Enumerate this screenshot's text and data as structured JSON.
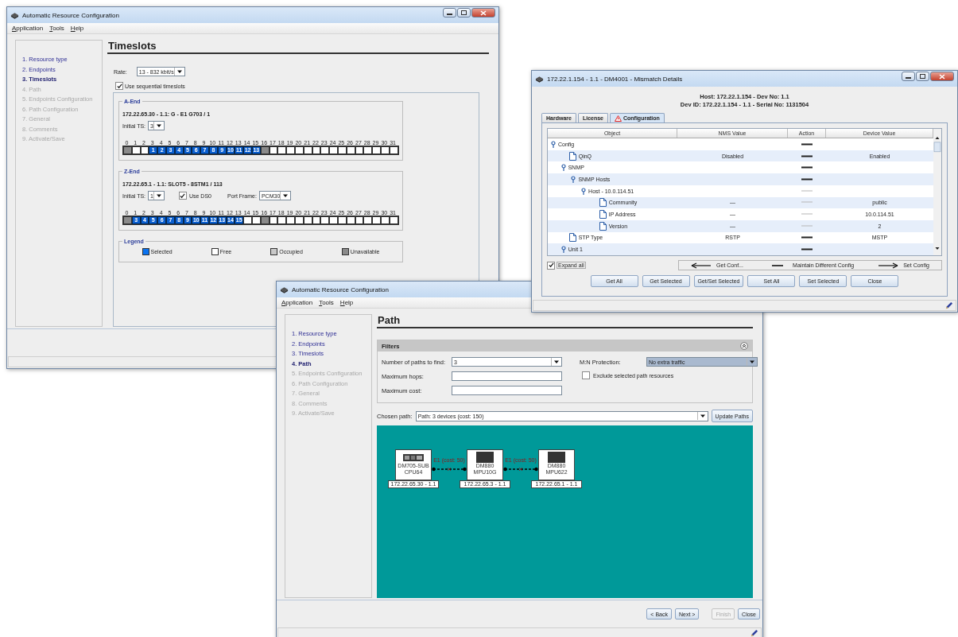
{
  "timeslots_window": {
    "title": "Automatic Resource Configuration",
    "menu": [
      "Application",
      "Tools",
      "Help"
    ],
    "steps": [
      {
        "label": "1. Resource type",
        "selected": false,
        "disabled": false
      },
      {
        "label": "2. Endpoints",
        "selected": false,
        "disabled": false
      },
      {
        "label": "3. Timeslots",
        "selected": true,
        "disabled": false
      },
      {
        "label": "4. Path",
        "selected": false,
        "disabled": true
      },
      {
        "label": "5. Endpoints Configuration",
        "selected": false,
        "disabled": true
      },
      {
        "label": "6. Path Configuration",
        "selected": false,
        "disabled": true
      },
      {
        "label": "7. General",
        "selected": false,
        "disabled": true
      },
      {
        "label": "8. Comments",
        "selected": false,
        "disabled": true
      },
      {
        "label": "9. Activate/Save",
        "selected": false,
        "disabled": true
      }
    ],
    "heading": "Timeslots",
    "rate": {
      "label": "Rate:",
      "value": "13 - 832 kbit/s"
    },
    "sequential": {
      "label": "Use sequential timeslots",
      "checked": true
    },
    "a_end": {
      "title": "A-End",
      "endpoint": "172.22.65.30 - 1.1: G - E1 G703 / 1",
      "initial_ts": {
        "label": "Initial TS:",
        "value": "3"
      },
      "slot_numbers": [
        "0",
        "1",
        "2",
        "3",
        "4",
        "5",
        "6",
        "7",
        "8",
        "9",
        "10",
        "11",
        "12",
        "13",
        "14",
        "15",
        "16",
        "17",
        "18",
        "19",
        "20",
        "21",
        "22",
        "23",
        "24",
        "25",
        "26",
        "27",
        "28",
        "29",
        "30",
        "31"
      ],
      "slots": [
        {
          "kind": "unavailable"
        },
        {
          "kind": "free"
        },
        {
          "kind": "free"
        },
        {
          "kind": "selected",
          "label": "1"
        },
        {
          "kind": "selected",
          "label": "2"
        },
        {
          "kind": "selected",
          "label": "3"
        },
        {
          "kind": "selected",
          "label": "4"
        },
        {
          "kind": "selected",
          "label": "5"
        },
        {
          "kind": "selected",
          "label": "6"
        },
        {
          "kind": "selected",
          "label": "7"
        },
        {
          "kind": "selected",
          "label": "8"
        },
        {
          "kind": "selected",
          "label": "9"
        },
        {
          "kind": "selected",
          "label": "10"
        },
        {
          "kind": "selected",
          "label": "11"
        },
        {
          "kind": "selected",
          "label": "12"
        },
        {
          "kind": "selected",
          "label": "13"
        },
        {
          "kind": "unavailable"
        },
        {
          "kind": "free"
        },
        {
          "kind": "free"
        },
        {
          "kind": "free"
        },
        {
          "kind": "free"
        },
        {
          "kind": "free"
        },
        {
          "kind": "free"
        },
        {
          "kind": "free"
        },
        {
          "kind": "free"
        },
        {
          "kind": "free"
        },
        {
          "kind": "free"
        },
        {
          "kind": "free"
        },
        {
          "kind": "free"
        },
        {
          "kind": "free"
        },
        {
          "kind": "free"
        },
        {
          "kind": "free"
        }
      ]
    },
    "z_end": {
      "title": "Z-End",
      "endpoint": "172.22.65.1 - 1.1: SLOT5 - 8STM1 / 113",
      "initial_ts": {
        "label": "Initial TS:",
        "value": "1"
      },
      "use_ds0": {
        "label": "Use DS0",
        "checked": true
      },
      "port_frame": {
        "label": "Port Frame:",
        "value": "PCM30"
      },
      "slot_numbers": [
        "0",
        "1",
        "2",
        "3",
        "4",
        "5",
        "6",
        "7",
        "8",
        "9",
        "10",
        "11",
        "12",
        "13",
        "14",
        "15",
        "16",
        "17",
        "18",
        "19",
        "20",
        "21",
        "22",
        "23",
        "24",
        "25",
        "26",
        "27",
        "28",
        "29",
        "30",
        "31"
      ],
      "slots": [
        {
          "kind": "unavailable"
        },
        {
          "kind": "selected",
          "label": "3"
        },
        {
          "kind": "selected",
          "label": "4"
        },
        {
          "kind": "selected",
          "label": "5"
        },
        {
          "kind": "selected",
          "label": "6"
        },
        {
          "kind": "selected",
          "label": "7"
        },
        {
          "kind": "selected",
          "label": "8"
        },
        {
          "kind": "selected",
          "label": "9"
        },
        {
          "kind": "selected",
          "label": "10"
        },
        {
          "kind": "selected",
          "label": "11"
        },
        {
          "kind": "selected",
          "label": "12"
        },
        {
          "kind": "selected",
          "label": "13"
        },
        {
          "kind": "selected",
          "label": "14"
        },
        {
          "kind": "selected",
          "label": "15"
        },
        {
          "kind": "free"
        },
        {
          "kind": "free"
        },
        {
          "kind": "unavailable"
        },
        {
          "kind": "free"
        },
        {
          "kind": "free"
        },
        {
          "kind": "free"
        },
        {
          "kind": "free"
        },
        {
          "kind": "free"
        },
        {
          "kind": "free"
        },
        {
          "kind": "free"
        },
        {
          "kind": "free"
        },
        {
          "kind": "free"
        },
        {
          "kind": "free"
        },
        {
          "kind": "free"
        },
        {
          "kind": "free"
        },
        {
          "kind": "free"
        },
        {
          "kind": "free"
        },
        {
          "kind": "free"
        }
      ]
    },
    "legend": {
      "title": "Legend",
      "items": [
        {
          "kind": "selected",
          "label": "Selected"
        },
        {
          "kind": "free",
          "label": "Free"
        },
        {
          "kind": "occupied",
          "label": "Occupied"
        },
        {
          "kind": "unavailable",
          "label": "Unavailable"
        }
      ]
    }
  },
  "path_window": {
    "title": "Automatic Resource Configuration",
    "menu": [
      "Application",
      "Tools",
      "Help"
    ],
    "steps": [
      {
        "label": "1. Resource type",
        "selected": false,
        "disabled": false
      },
      {
        "label": "2. Endpoints",
        "selected": false,
        "disabled": false
      },
      {
        "label": "3. Timeslots",
        "selected": false,
        "disabled": false
      },
      {
        "label": "4. Path",
        "selected": true,
        "disabled": false
      },
      {
        "label": "5. Endpoints Configuration",
        "selected": false,
        "disabled": true
      },
      {
        "label": "6. Path Configuration",
        "selected": false,
        "disabled": true
      },
      {
        "label": "7. General",
        "selected": false,
        "disabled": true
      },
      {
        "label": "8. Comments",
        "selected": false,
        "disabled": true
      },
      {
        "label": "9. Activate/Save",
        "selected": false,
        "disabled": true
      }
    ],
    "heading": "Path",
    "filters": {
      "title": "Filters",
      "paths_to_find": {
        "label": "Number of paths to find:",
        "value": "3"
      },
      "max_hops": {
        "label": "Maximum hops:"
      },
      "max_cost": {
        "label": "Maximum cost:"
      },
      "protection": {
        "label": "M:N Protection:",
        "value": "No extra traffic",
        "disabled": true
      },
      "exclude": {
        "label": "Exclude selected path resources",
        "checked": false
      }
    },
    "chosen_path": {
      "label": "Chosen path:",
      "value": "Path: 3 devices (cost: 150)"
    },
    "update_button": "Update Paths",
    "diagram": {
      "nodes": [
        {
          "kind": "board",
          "lines": [
            "DM705-SUB",
            "CPU64"
          ],
          "address": "172.22.65.30 - 1.1"
        },
        {
          "kind": "chassis",
          "lines": [
            "DM880",
            "MPU10G"
          ],
          "address": "172.22.65.3 - 1.1"
        },
        {
          "kind": "chassis",
          "lines": [
            "DM880",
            "MPU622"
          ],
          "address": "172.22.65.1 - 1.1"
        }
      ],
      "links": [
        {
          "label": "E1 (cost: 50)"
        },
        {
          "label": "E1 (cost: 50)"
        }
      ]
    },
    "buttons": [
      {
        "label": "< Back",
        "disabled": false
      },
      {
        "label": "Next >",
        "disabled": false
      },
      {
        "label": "Finish",
        "disabled": true
      },
      {
        "label": "Close",
        "disabled": false
      }
    ]
  },
  "mismatch_window": {
    "title": "172.22.1.154 - 1.1 - DM4001 - Mismatch Details",
    "header": [
      "Host: 172.22.1.154 - Dev No: 1.1",
      "Dev ID: 172.22.1.154 - 1.1 - Serial No: 1131504"
    ],
    "tabs": [
      {
        "label": "Hardware",
        "selected": false,
        "warning": false
      },
      {
        "label": "License",
        "selected": false,
        "warning": false
      },
      {
        "label": "Configuration",
        "selected": true,
        "warning": true
      }
    ],
    "columns": [
      "Object",
      "NMS Value",
      "Action",
      "Device Value"
    ],
    "rows": [
      {
        "label": "Config",
        "kind": "branch",
        "action_disabled": false,
        "children": [
          {
            "label": "QinQ",
            "kind": "leaf",
            "nms_value": "Disabled",
            "device_value": "Enabled",
            "action_disabled": false
          },
          {
            "label": "SNMP",
            "kind": "branch",
            "action_disabled": false,
            "children": [
              {
                "label": "SNMP Hosts",
                "kind": "branch",
                "action_disabled": false,
                "children": [
                  {
                    "label": "Host - 10.0.114.51",
                    "kind": "branch",
                    "action_disabled": true,
                    "children": [
                      {
                        "label": "Community",
                        "kind": "leaf",
                        "nms_value": "—",
                        "device_value": "public",
                        "action_disabled": true
                      },
                      {
                        "label": "IP Address",
                        "kind": "leaf",
                        "nms_value": "—",
                        "device_value": "10.0.114.51",
                        "action_disabled": true
                      },
                      {
                        "label": "Version",
                        "kind": "leaf",
                        "nms_value": "—",
                        "device_value": "2",
                        "action_disabled": true
                      }
                    ]
                  }
                ]
              }
            ]
          },
          {
            "label": "STP Type",
            "kind": "leaf",
            "nms_value": "RSTP",
            "device_value": "MSTP",
            "action_disabled": false
          },
          {
            "label": "Unit 1",
            "kind": "branch",
            "action_disabled": false
          }
        ]
      }
    ],
    "expand_all": {
      "label": "Expand all",
      "checked": true
    },
    "legend": [
      {
        "kind": "get",
        "label": "Get Conf..."
      },
      {
        "kind": "maintain",
        "label": "Maintain Different Config"
      },
      {
        "kind": "set",
        "label": "Set Config"
      }
    ],
    "buttons": [
      "Get All",
      "Get Selected",
      "Get/Set Selected",
      "Set All",
      "Set Selected",
      "Close"
    ]
  }
}
